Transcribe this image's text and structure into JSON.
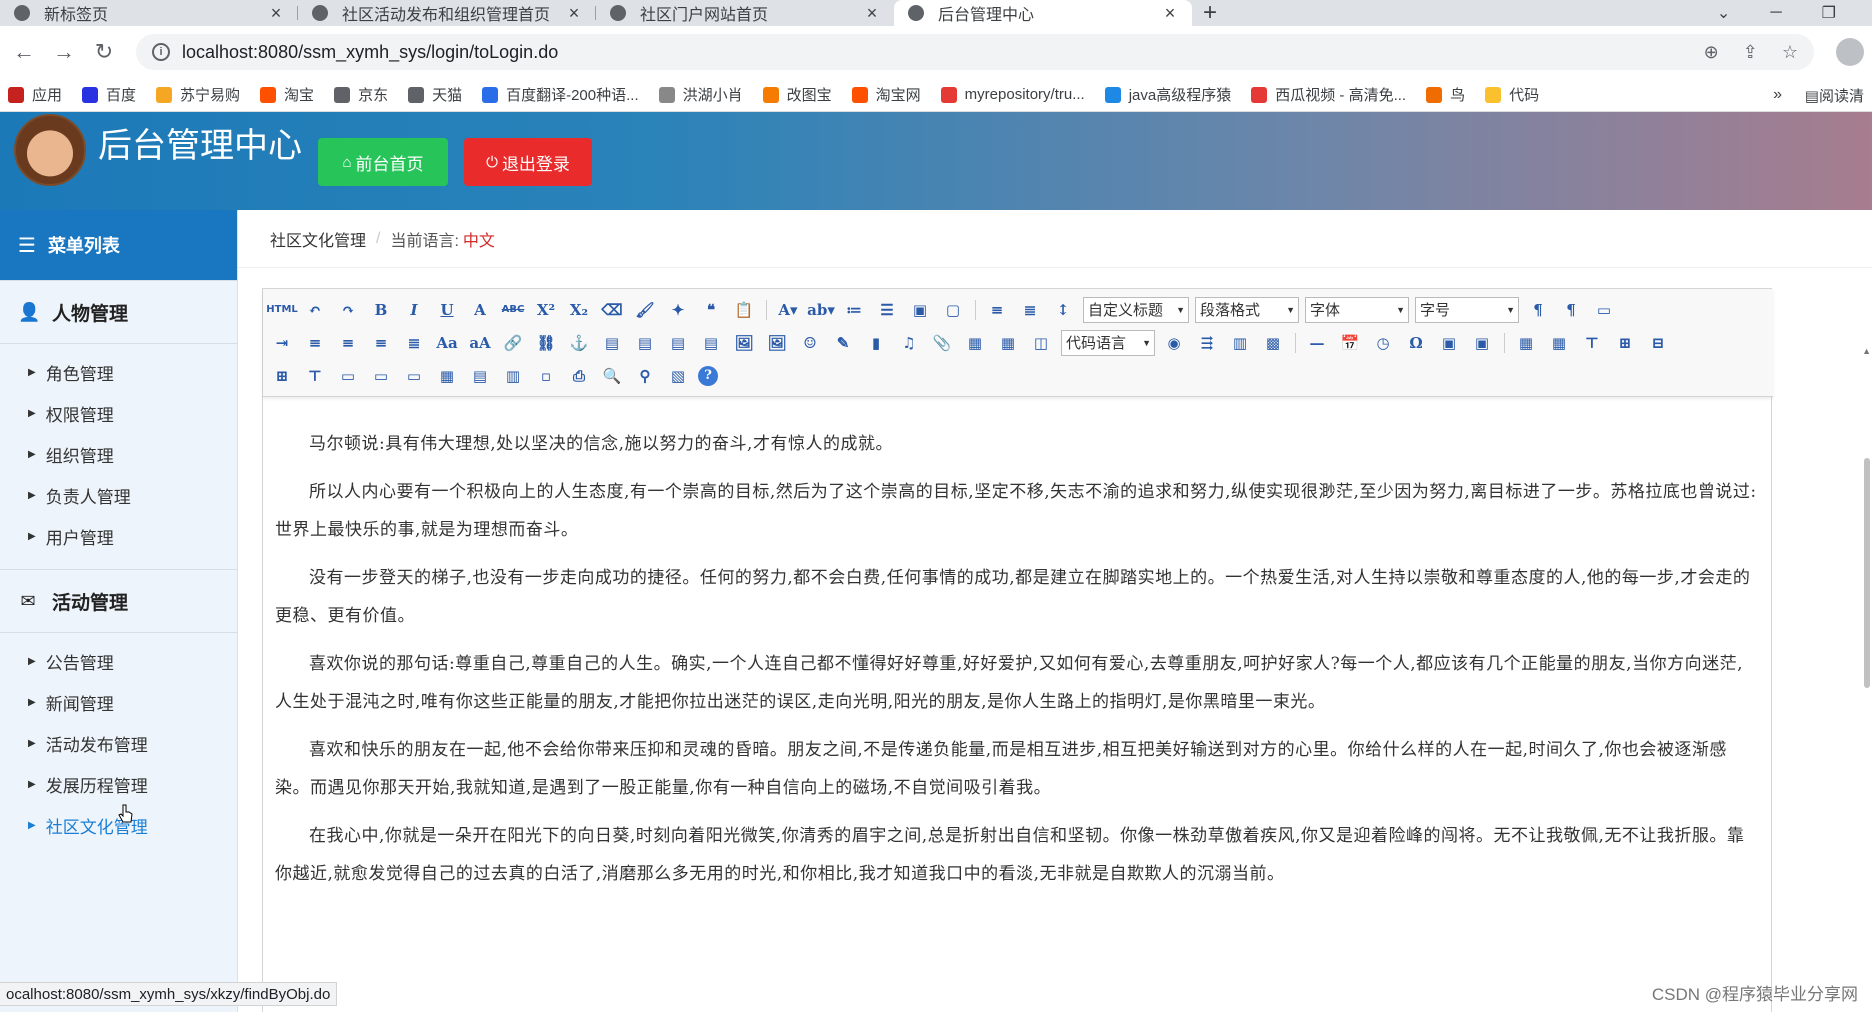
{
  "browser": {
    "tabs": [
      {
        "title": "新标签页",
        "active": false
      },
      {
        "title": "社区活动发布和组织管理首页",
        "active": false
      },
      {
        "title": "社区门户网站首页",
        "active": false
      },
      {
        "title": "后台管理中心",
        "active": true
      }
    ],
    "url": "localhost:8080/ssm_xymh_sys/login/toLogin.do",
    "bookmarks": [
      {
        "label": "应用",
        "color": "#c5221f"
      },
      {
        "label": "百度",
        "color": "#2932e1"
      },
      {
        "label": "苏宁易购",
        "color": "#f5a623"
      },
      {
        "label": "淘宝",
        "color": "#ff5000"
      },
      {
        "label": "京东",
        "color": "#5f6368"
      },
      {
        "label": "天猫",
        "color": "#5f6368"
      },
      {
        "label": "百度翻译-200种语...",
        "color": "#2b6de8"
      },
      {
        "label": "洪湖小肖",
        "color": "#888888"
      },
      {
        "label": "改图宝",
        "color": "#f57c00"
      },
      {
        "label": "淘宝网",
        "color": "#ff5000"
      },
      {
        "label": "myrepository/tru...",
        "color": "#e53935"
      },
      {
        "label": "java高级程序猿",
        "color": "#1e88e5"
      },
      {
        "label": "西瓜视频 - 高清免...",
        "color": "#e53935"
      },
      {
        "label": "鸟",
        "color": "#ef6c00"
      },
      {
        "label": "代码",
        "color": "#fbc02d"
      }
    ],
    "bookmarks_more": "»",
    "reading_list": "阅读清",
    "status_url": "ocalhost:8080/ssm_xymh_sys/xkzy/findByObj.do"
  },
  "header": {
    "title": "后台管理中心",
    "home_button": "前台首页",
    "logout_button": "退出登录"
  },
  "sidebar": {
    "menu_title": "菜单列表",
    "groups": [
      {
        "title": "人物管理",
        "items": [
          "角色管理",
          "权限管理",
          "组织管理",
          "负责人管理",
          "用户管理"
        ]
      },
      {
        "title": "活动管理",
        "items": [
          "公告管理",
          "新闻管理",
          "活动发布管理",
          "发展历程管理",
          "社区文化管理"
        ]
      }
    ],
    "active_item": "社区文化管理"
  },
  "breadcrumb": {
    "section": "社区文化管理",
    "lang_label": "当前语言:",
    "lang_value": "中文"
  },
  "editor": {
    "selects": {
      "custom_title": "自定义标题",
      "paragraph": "段落格式",
      "font_family": "字体",
      "font_size": "字号",
      "code_lang": "代码语言"
    },
    "paragraphs": [
      "马尔顿说:具有伟大理想,处以坚决的信念,施以努力的奋斗,才有惊人的成就。",
      "所以人内心要有一个积极向上的人生态度,有一个崇高的目标,然后为了这个崇高的目标,坚定不移,矢志不渝的追求和努力,纵使实现很渺茫,至少因为努力,离目标进了一步。苏格拉底也曾说过:世界上最快乐的事,就是为理想而奋斗。",
      "没有一步登天的梯子,也没有一步走向成功的捷径。任何的努力,都不会白费,任何事情的成功,都是建立在脚踏实地上的。一个热爱生活,对人生持以崇敬和尊重态度的人,他的每一步,才会走的更稳、更有价值。",
      "喜欢你说的那句话:尊重自己,尊重自己的人生。确实,一个人连自己都不懂得好好尊重,好好爱护,又如何有爱心,去尊重朋友,呵护好家人?每一个人,都应该有几个正能量的朋友,当你方向迷茫,人生处于混沌之时,唯有你这些正能量的朋友,才能把你拉出迷茫的误区,走向光明,阳光的朋友,是你人生路上的指明灯,是你黑暗里一束光。",
      "喜欢和快乐的朋友在一起,他不会给你带来压抑和灵魂的昏暗。朋友之间,不是传递负能量,而是相互进步,相互把美好输送到对方的心里。你给什么样的人在一起,时间久了,你也会被逐渐感染。而遇见你那天开始,我就知道,是遇到了一股正能量,你有一种自信向上的磁场,不自觉间吸引着我。",
      "在我心中,你就是一朵开在阳光下的向日葵,时刻向着阳光微笑,你清秀的眉宇之间,总是折射出自信和坚韧。你像一株劲草傲着疾风,你又是迎着险峰的闯将。无不让我敬佩,无不让我折服。靠你越近,就愈发觉得自己的过去真的白活了,消磨那么多无用的时光,和你相比,我才知道我口中的看淡,无非就是自欺欺人的沉溺当前。"
    ]
  },
  "watermark": "CSDN @程序猿毕业分享网"
}
